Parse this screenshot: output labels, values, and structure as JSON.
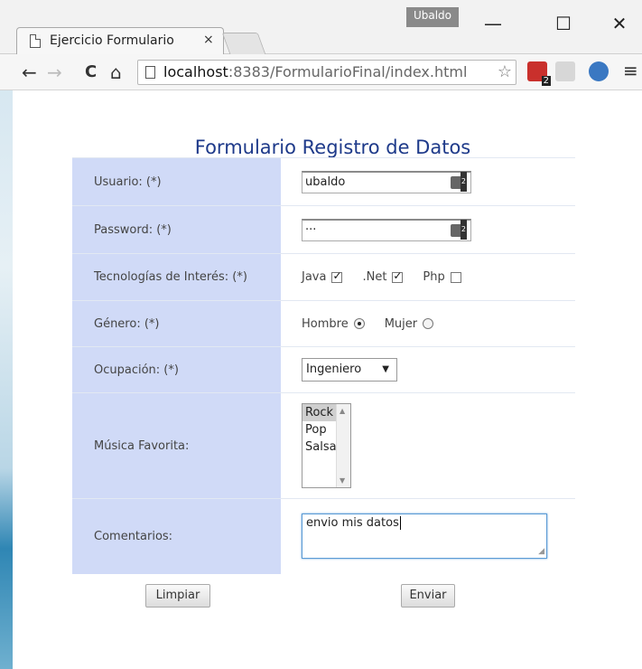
{
  "browser": {
    "tab_title": "Ejercicio Formulario",
    "tab_close": "×",
    "profile_name": "Ubaldo",
    "window_minimize": "—",
    "window_maximize": "☐",
    "window_close": "✕",
    "url_host": "localhost",
    "url_rest": ":8383/FormularioFinal/index.html",
    "nav_back": "←",
    "nav_forward": "→",
    "nav_reload": "C",
    "nav_home": "⌂",
    "star": "☆",
    "menu": "≡"
  },
  "form": {
    "title": "Formulario Registro de Datos",
    "usuario_label": "Usuario: (*)",
    "usuario_value": "ubaldo",
    "password_label": "Password: (*)",
    "password_value": "···",
    "tecnologias_label": "Tecnologías de Interés: (*)",
    "tecnologias": [
      {
        "label": "Java",
        "checked": true
      },
      {
        "label": ".Net",
        "checked": true
      },
      {
        "label": "Php",
        "checked": false
      }
    ],
    "genero_label": "Género: (*)",
    "genero": [
      {
        "label": "Hombre",
        "selected": true
      },
      {
        "label": "Mujer",
        "selected": false
      }
    ],
    "ocupacion_label": "Ocupación: (*)",
    "ocupacion_value": "Ingeniero",
    "musica_label": "Música Favorita:",
    "musica_options": [
      "Rock",
      "Pop",
      "Salsa"
    ],
    "musica_selected": "Rock",
    "comentarios_label": "Comentarios:",
    "comentarios_value": "envio mis datos",
    "btn_limpiar": "Limpiar",
    "btn_enviar": "Enviar"
  },
  "colors": {
    "label_bg": "#d0daf7",
    "title_color": "#1e3a8a"
  }
}
